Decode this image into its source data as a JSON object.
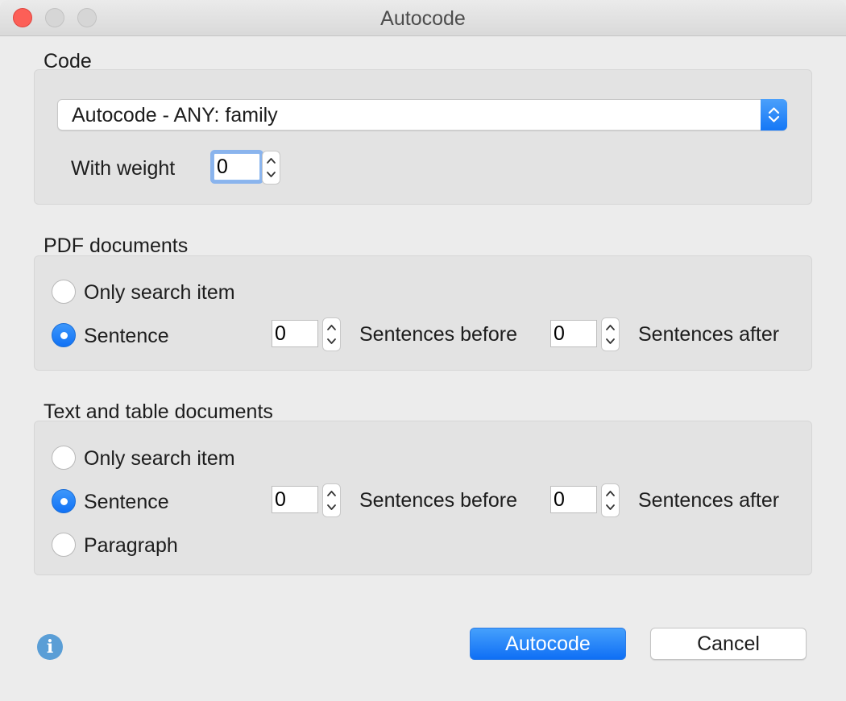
{
  "window": {
    "title": "Autocode"
  },
  "code_section": {
    "heading": "Code",
    "selected_code": "Autocode - ANY: family",
    "weight_label": "With weight",
    "weight_value": "0"
  },
  "pdf_section": {
    "heading": "PDF documents",
    "options": [
      {
        "label": "Only search item",
        "selected": false
      },
      {
        "label": "Sentence",
        "selected": true
      }
    ],
    "before_value": "0",
    "before_label": "Sentences before",
    "after_value": "0",
    "after_label": "Sentences after"
  },
  "text_section": {
    "heading": "Text and table documents",
    "options": [
      {
        "label": "Only search item",
        "selected": false
      },
      {
        "label": "Sentence",
        "selected": true
      },
      {
        "label": "Paragraph",
        "selected": false
      }
    ],
    "before_value": "0",
    "before_label": "Sentences before",
    "after_value": "0",
    "after_label": "Sentences after"
  },
  "buttons": {
    "primary": "Autocode",
    "secondary": "Cancel"
  },
  "icons": {
    "info": "info-icon",
    "close": "close-window-icon",
    "minimize": "minimize-window-icon",
    "maximize": "zoom-window-icon"
  },
  "colors": {
    "accent": "#1577f6",
    "close": "#fc5f57"
  }
}
